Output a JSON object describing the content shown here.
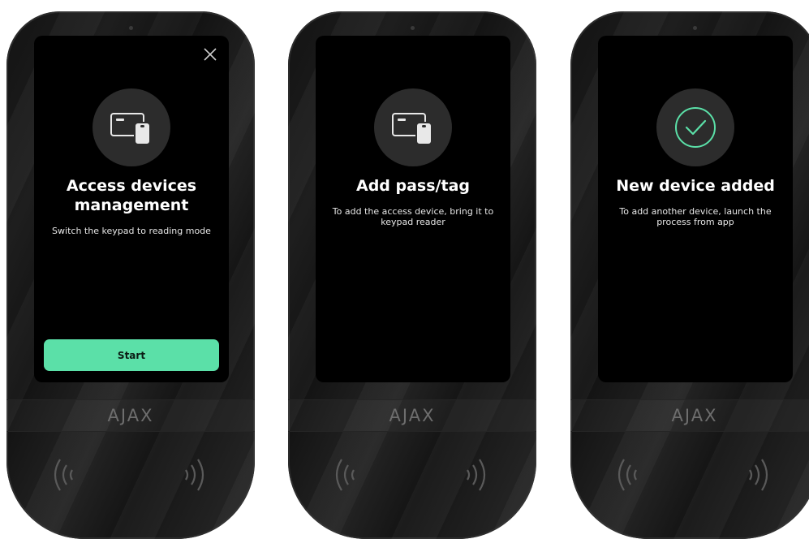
{
  "brand": "AJAX",
  "colors": {
    "accent": "#5be0a8",
    "screen": "#000000",
    "icon_circle": "#2c2c2c",
    "check": "#5be0a8"
  },
  "screens": [
    {
      "title_line1": "Access devices",
      "title_line2": "management",
      "subtitle": "Switch the keypad to reading mode",
      "button_label": "Start",
      "icon": "card-tag-icon",
      "has_close": true
    },
    {
      "title_line1": "Add pass/tag",
      "subtitle_line1": "To add the access device, bring it to",
      "subtitle_line2": "keypad reader",
      "icon": "card-tag-icon"
    },
    {
      "title_line1": "New device added",
      "subtitle_line1": "To add another device, launch the",
      "subtitle_line2": "process from app",
      "icon": "checkmark-circle-icon"
    }
  ],
  "icons": {
    "close": "close-icon",
    "nfc_left": "nfc-waves-left-icon",
    "nfc_right": "nfc-waves-right-icon"
  }
}
